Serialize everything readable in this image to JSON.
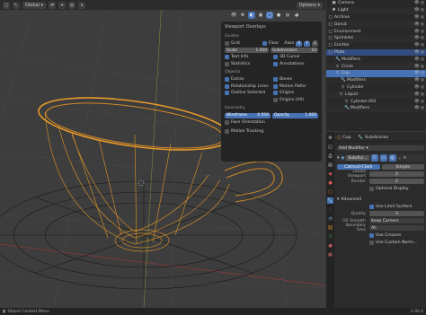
{
  "header": {
    "orientation": "Global",
    "options": "Options"
  },
  "overlays": {
    "title": "Viewport Overlays",
    "guides_title": "Guides",
    "grid": "Grid",
    "floor": "Floor",
    "axes": "Axes",
    "x": "X",
    "y": "Y",
    "z": "Z",
    "scale": "Scale",
    "scale_val": "1.000",
    "subdivisions": "Subdivisions",
    "subdiv_val": "10",
    "text_info": "Text Info",
    "cursor": "3D Cursor",
    "statistics": "Statistics",
    "annotations": "Annotations",
    "objects_title": "Objects",
    "extras": "Extras",
    "bones": "Bones",
    "rel_lines": "Relationship Lines",
    "motion_paths": "Motion Paths",
    "outline": "Outline Selected",
    "origins": "Origins",
    "origins_all": "Origins (All)",
    "geometry_title": "Geometry",
    "wireframe": "Wireframe",
    "wire_val": "0.500",
    "opacity": "Opacity",
    "opacity_val": "1.000",
    "face_orient": "Face Orientation",
    "motion_tracking": "Motion Tracking"
  },
  "outliner": [
    {
      "label": "Camera",
      "glyph": "▣",
      "indent": 6
    },
    {
      "label": "Light",
      "glyph": "✹",
      "indent": 6
    },
    {
      "label": "Archive",
      "glyph": "▢",
      "indent": 2
    },
    {
      "label": "Donut",
      "glyph": "▢",
      "indent": 2
    },
    {
      "label": "Environment",
      "glyph": "▢",
      "indent": 2
    },
    {
      "label": "Sprinkles",
      "glyph": "▢",
      "indent": 2
    },
    {
      "label": "Emitter",
      "glyph": "▢",
      "indent": 2
    },
    {
      "label": "Plate",
      "glyph": "▢",
      "indent": 2
    },
    {
      "label": "Modifiers",
      "glyph": "🔧",
      "indent": 10
    },
    {
      "label": "Circle",
      "glyph": "▽",
      "indent": 10
    },
    {
      "label": "Cup",
      "glyph": "▽",
      "indent": 10
    },
    {
      "label": "Modifiers",
      "glyph": "🔧",
      "indent": 16
    },
    {
      "label": "Cylinder",
      "glyph": "▽",
      "indent": 16
    },
    {
      "label": "Liquid",
      "glyph": "▽",
      "indent": 14
    },
    {
      "label": "Cylinder.001",
      "glyph": "▽",
      "indent": 20
    },
    {
      "label": "Modifiers",
      "glyph": "🔧",
      "indent": 20
    }
  ],
  "properties": {
    "object": "Cup",
    "modifier_name": "Subdivision",
    "add_modifier": "Add Modifier",
    "mod_label": "Subdivi...",
    "catmull": "Catmull-Clark",
    "simple": "Simple",
    "levels_vp": "Levels Viewport",
    "levels_vp_val": "2",
    "render": "Render",
    "render_val": "2",
    "optimal": "Optimal Display",
    "advanced": "Advanced",
    "limit_surface": "Use Limit Surface",
    "quality": "Quality",
    "quality_val": "3",
    "uv_smooth": "UV Smooth",
    "uv_smooth_val": "Keep Corners",
    "boundary": "Boundary Smo",
    "boundary_val": "All",
    "creases": "Use Creases",
    "custom_normals": "Use Custom Norm..."
  },
  "status": {
    "left": "Object Context Menu",
    "right": "2.92.0"
  },
  "colors": {
    "accent": "#4772b3",
    "selection_orange": "#f5a623"
  }
}
